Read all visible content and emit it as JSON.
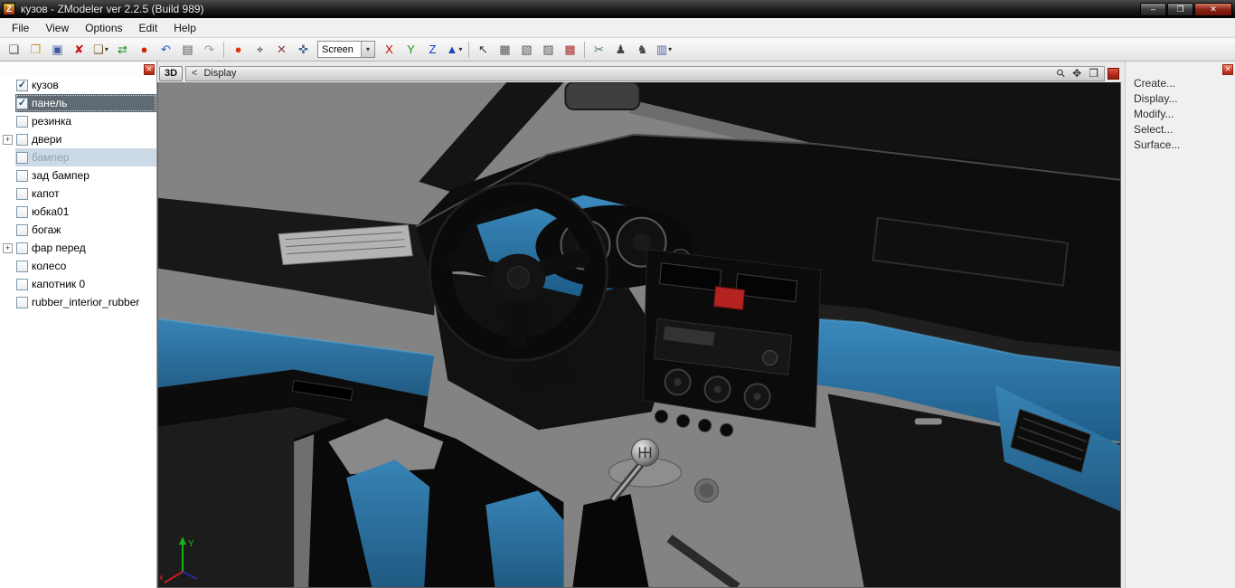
{
  "window": {
    "title": "кузов - ZModeler ver 2.2.5 (Build 989)",
    "logo_glyph": "Z",
    "minimize_glyph": "–",
    "maximize_glyph": "❐",
    "close_glyph": "✕"
  },
  "menu": {
    "items": [
      "File",
      "View",
      "Options",
      "Edit",
      "Help"
    ]
  },
  "toolbar": {
    "buttons_left": [
      {
        "button": "new-file-button",
        "icon": "new-file-icon",
        "glyph": "❏",
        "color": "#4a4a4a"
      },
      {
        "button": "open-file-button",
        "icon": "open-folder-icon",
        "glyph": "❒",
        "color": "#c29a2e"
      },
      {
        "button": "save-button",
        "icon": "save-floppy-icon",
        "glyph": "▣",
        "color": "#3a5a9a"
      },
      {
        "button": "delete-button",
        "icon": "delete-x-icon",
        "glyph": "✘",
        "color": "#cc1111"
      },
      {
        "button": "paste-special-button",
        "icon": "clipboard-icon",
        "glyph": "❑",
        "color": "#7a5a2a",
        "caret": true
      },
      {
        "button": "import-export-button",
        "icon": "import-export-icon",
        "glyph": "⇄",
        "color": "#1a8a1a"
      },
      {
        "button": "record-button",
        "icon": "record-dot-icon",
        "glyph": "●",
        "color": "#cc2200"
      },
      {
        "button": "undo-button",
        "icon": "undo-icon",
        "glyph": "↶",
        "color": "#2255cc"
      },
      {
        "button": "notes-button",
        "icon": "notes-icon",
        "glyph": "▤",
        "color": "#555555"
      },
      {
        "button": "redo-button",
        "icon": "redo-icon",
        "glyph": "↷",
        "color": "#9a9a9a"
      },
      {
        "sep": true
      },
      {
        "button": "render-button",
        "icon": "material-sphere-icon",
        "glyph": "●",
        "color": "#dd3311"
      },
      {
        "button": "vertex-snap-button",
        "icon": "vertex-snap-icon",
        "glyph": "⌖",
        "color": "#444444"
      },
      {
        "button": "vertex-weld-button",
        "icon": "vertex-weld-icon",
        "glyph": "✕",
        "color": "#884444"
      },
      {
        "button": "normals-button",
        "icon": "normals-icon",
        "glyph": "✜",
        "color": "#446688"
      }
    ],
    "screen_dropdown": {
      "value": "Screen",
      "caret": "▾"
    },
    "buttons_right": [
      {
        "button": "axis-x-button",
        "icon": "axis-x-icon",
        "glyph": "X",
        "color": "#cc0000"
      },
      {
        "button": "axis-y-button",
        "icon": "axis-y-icon",
        "glyph": "Y",
        "color": "#119911"
      },
      {
        "button": "axis-z-button",
        "icon": "axis-z-icon",
        "glyph": "Z",
        "color": "#1133cc"
      },
      {
        "button": "gizmo-mode-button",
        "icon": "cone-icon",
        "glyph": "▲",
        "color": "#2244bb",
        "caret": true
      },
      {
        "sep": true
      },
      {
        "button": "select-mode-button",
        "icon": "select-arrow-icon",
        "glyph": "↖",
        "color": "#333333"
      },
      {
        "button": "vertices-mode-button",
        "icon": "vertices-cube-icon",
        "glyph": "▦",
        "color": "#555555"
      },
      {
        "button": "edges-mode-button",
        "icon": "edges-cube-icon",
        "glyph": "▧",
        "color": "#555555"
      },
      {
        "button": "faces-mode-button",
        "icon": "faces-cube-icon",
        "glyph": "▨",
        "color": "#555555"
      },
      {
        "button": "objects-mode-button",
        "icon": "objects-cube-icon",
        "glyph": "▩",
        "color": "#aa3333"
      },
      {
        "sep": true
      },
      {
        "button": "detach-button",
        "icon": "scissors-icon",
        "glyph": "✂",
        "color": "#557755"
      },
      {
        "button": "skeleton-button",
        "icon": "person-icon",
        "glyph": "♟",
        "color": "#444444"
      },
      {
        "button": "animation-button",
        "icon": "walking-person-icon",
        "glyph": "♞",
        "color": "#444444"
      },
      {
        "button": "layers-button",
        "icon": "layers-grid-icon",
        "glyph": "▥",
        "color": "#5566aa",
        "caret": true
      }
    ]
  },
  "scene_panel": {
    "close_glyph": "✕",
    "items": [
      {
        "label": "кузов",
        "checked": true
      },
      {
        "label": "панель",
        "checked": true,
        "selected": true
      },
      {
        "label": "резинка"
      },
      {
        "label": "двери",
        "expandable": true
      },
      {
        "label": "бампер",
        "inactiveSelected": true
      },
      {
        "label": "зад бампер"
      },
      {
        "label": "капот"
      },
      {
        "label": "юбка01"
      },
      {
        "label": "богаж"
      },
      {
        "label": "фар перед",
        "expandable": true
      },
      {
        "label": "колесо"
      },
      {
        "label": "капотник 0"
      },
      {
        "label": "rubber_interior_rubber"
      }
    ]
  },
  "viewport": {
    "mode_label": "3D",
    "back_glyph": "<",
    "view_label": "Display",
    "zoom_glyph": "⚲",
    "pan_glyph": "✥",
    "fit_glyph": "❒",
    "axis_y_label": "Y",
    "axis_x_label": "x"
  },
  "command_panel": {
    "close_glyph": "✕",
    "items": [
      "Create...",
      "Display...",
      "Modify...",
      "Select...",
      "Surface..."
    ]
  },
  "colors": {
    "accent_blue": "#2e7fb2",
    "selection_dark": "#5f6a73",
    "selection_inactive": "#ccd9e6",
    "close_red": "#cc3a24",
    "viewport_gray": "#838383"
  }
}
